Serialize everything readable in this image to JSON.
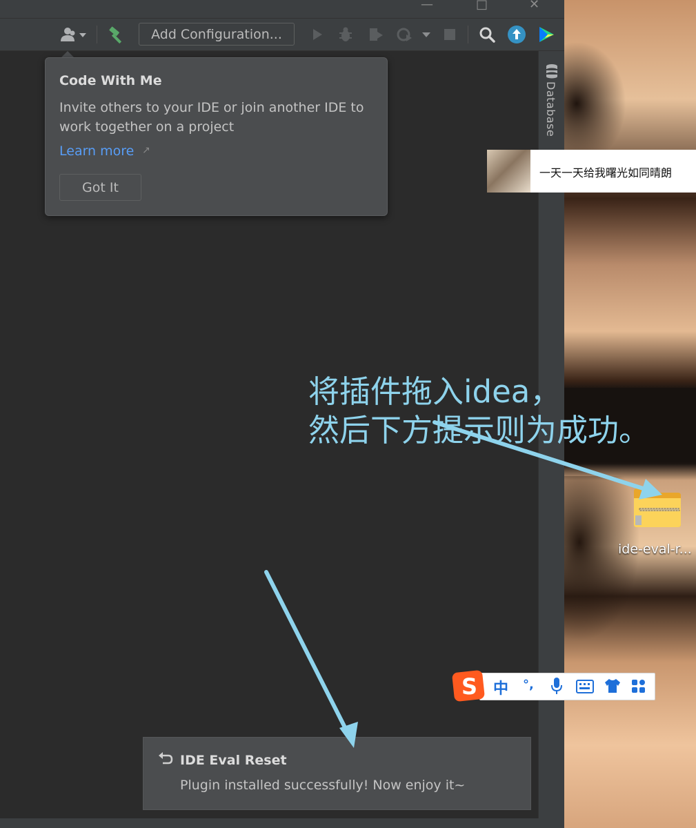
{
  "ide": {
    "toolbar": {
      "config_label": "Add Configuration..."
    },
    "sidebar_right": {
      "database_label": "Database"
    },
    "popup": {
      "title": "Code With Me",
      "description": "Invite others to your IDE or join another IDE to work together on a project",
      "link_label": "Learn more",
      "button_label": "Got It"
    },
    "notification": {
      "title": "IDE Eval Reset",
      "message": "Plugin installed successfully! Now enjoy it~"
    }
  },
  "desktop": {
    "music_widget": {
      "song": "一天一天给我曙光如同晴朗"
    },
    "file_icon": {
      "label": "ide-eval-r..."
    },
    "ime_bar": {
      "mode": "中",
      "punct": "°,"
    }
  },
  "annotation": {
    "line1": "将插件拖入idea，",
    "line2": "然后下方提示则为成功。"
  },
  "colors": {
    "ide_bg": "#2b2b2b",
    "panel_bg": "#3c3f41",
    "popup_bg": "#4b4d4f",
    "link": "#589df6",
    "annotation": "#8ed3ec"
  }
}
